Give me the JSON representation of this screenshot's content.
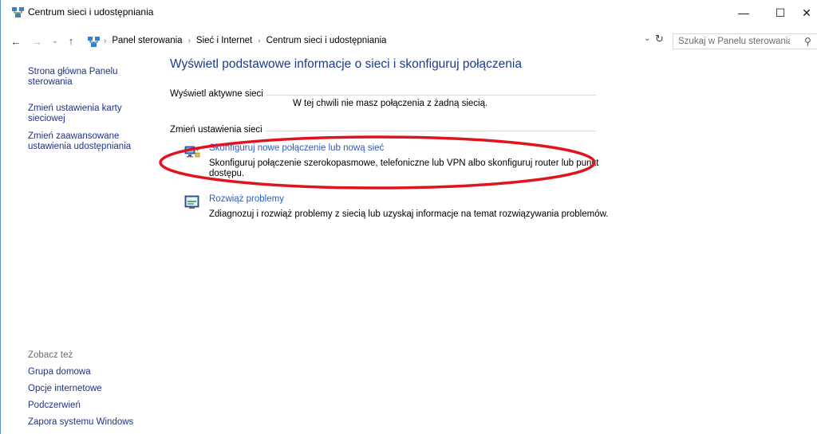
{
  "window": {
    "title": "Centrum sieci i udostępniania",
    "controls": {
      "minimize": "—",
      "maximize": "☐",
      "close": "✕"
    }
  },
  "addressbar": {
    "back": "←",
    "forward": "→",
    "history": "⌄",
    "up": "↑",
    "breadcrumbs": [
      "Panel sterowania",
      "Sieć i Internet",
      "Centrum sieci i udostępniania"
    ],
    "separator": "›",
    "dropdown": "⌄",
    "refresh": "↻"
  },
  "search": {
    "placeholder": "Szukaj w Panelu sterowania",
    "icon": "⚲"
  },
  "sidebar": {
    "links": [
      {
        "lines": [
          "Strona główna Panelu",
          "sterowania"
        ]
      },
      {
        "lines": [
          "Zmień ustawienia karty",
          "sieciowej"
        ]
      },
      {
        "lines": [
          "Zmień zaawansowane",
          "ustawienia udostępniania"
        ]
      }
    ],
    "see_also_label": "Zobacz też",
    "see_also": [
      "Grupa domowa",
      "Opcje internetowe",
      "Podczerwień",
      "Zapora systemu Windows"
    ]
  },
  "main": {
    "title": "Wyświetl podstawowe informacje o sieci i skonfiguruj połączenia",
    "active_networks_label": "Wyświetl aktywne sieci",
    "no_connection_text": "W tej chwili nie masz połączenia z żadną siecią.",
    "change_settings_label": "Zmień ustawienia sieci",
    "tasks": [
      {
        "link": "Skonfiguruj nowe połączenie lub nową sieć",
        "desc_lines": [
          "Skonfiguruj połączenie szerokopasmowe, telefoniczne lub VPN albo skonfiguruj router lub punkt",
          "dostępu."
        ]
      },
      {
        "link": "Rozwiąż problemy",
        "desc_lines": [
          "Zdiagnozuj i rozwiąż problemy z siecią lub uzyskaj informacje na temat rozwiązywania problemów."
        ]
      }
    ]
  },
  "colors": {
    "link": "#1e3287",
    "task_link": "#2a5cc2",
    "title": "#1e3a8a",
    "annotation": "#e0141e",
    "muted": "#6d6d6d"
  }
}
